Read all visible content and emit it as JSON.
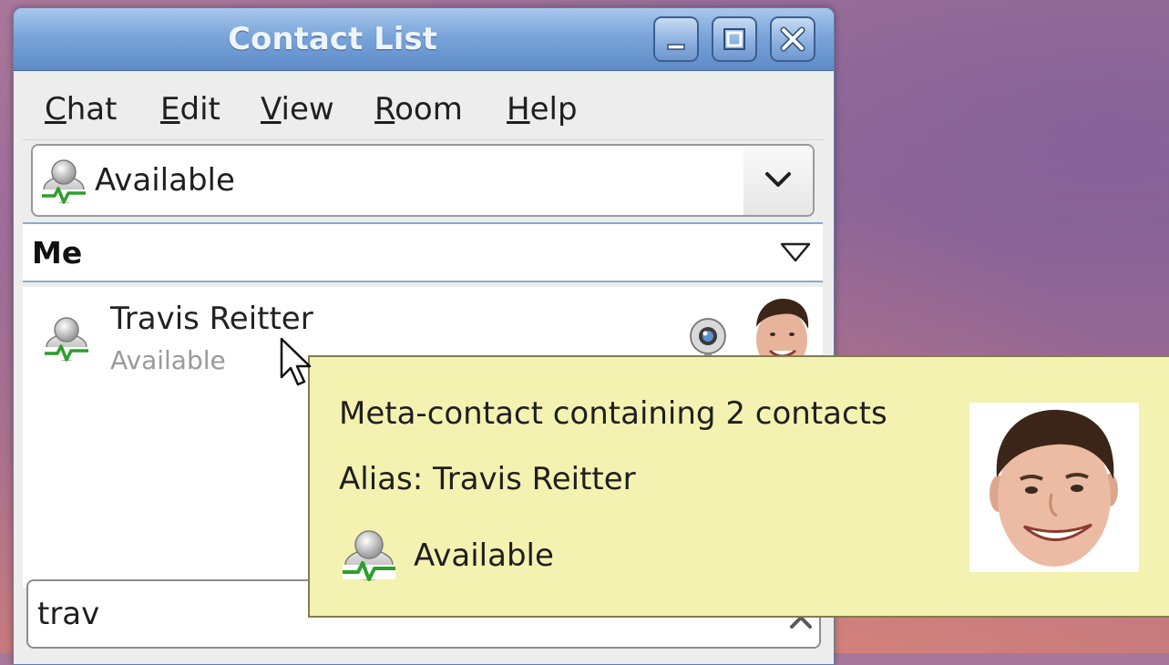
{
  "window": {
    "title": "Contact List",
    "controls": [
      "minimize",
      "maximize",
      "close"
    ]
  },
  "menubar": {
    "items": [
      {
        "mnemonic": "C",
        "rest": "hat"
      },
      {
        "mnemonic": "E",
        "rest": "dit"
      },
      {
        "mnemonic": "V",
        "rest": "iew"
      },
      {
        "mnemonic": "R",
        "rest": "oom"
      },
      {
        "mnemonic": "H",
        "rest": "elp"
      }
    ]
  },
  "status_selector": {
    "value": "Available",
    "icon": "available-status-icon"
  },
  "groups": [
    {
      "name": "Me",
      "expanded": true,
      "contacts": [
        {
          "name": "Travis Reitter",
          "status": "Available",
          "icons": [
            "available-status-icon",
            "webcam-icon",
            "avatar"
          ]
        }
      ]
    }
  ],
  "search": {
    "value": "trav"
  },
  "tooltip": {
    "summary": "Meta-contact containing 2 contacts",
    "alias": "Alias: Travis Reitter",
    "status": "Available"
  },
  "colors": {
    "titlebar": "#7aa5da",
    "tooltip_bg": "#f4f2b0",
    "status_green": "#2e9e2a"
  }
}
